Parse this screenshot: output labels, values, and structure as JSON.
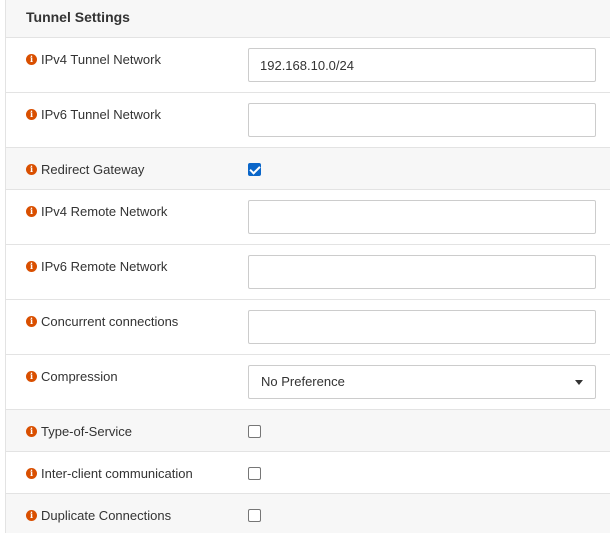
{
  "section": {
    "title": "Tunnel Settings"
  },
  "colors": {
    "info_icon": "#d94f00",
    "checkbox_checked": "#0a66c9",
    "row_shade": "#f7f7f7",
    "border": "#e3e3e3"
  },
  "info_icon": {
    "glyph": "i",
    "icon": "info-circle"
  },
  "fields": {
    "ipv4_tunnel_network": {
      "label": "IPv4 Tunnel Network",
      "value": "192.168.10.0/24"
    },
    "ipv6_tunnel_network": {
      "label": "IPv6 Tunnel Network",
      "value": ""
    },
    "redirect_gateway": {
      "label": "Redirect Gateway",
      "checked": true
    },
    "ipv4_remote_network": {
      "label": "IPv4 Remote Network",
      "value": ""
    },
    "ipv6_remote_network": {
      "label": "IPv6 Remote Network",
      "value": ""
    },
    "concurrent_connections": {
      "label": "Concurrent connections",
      "value": ""
    },
    "compression": {
      "label": "Compression",
      "selected": "No Preference"
    },
    "type_of_service": {
      "label": "Type-of-Service",
      "checked": false
    },
    "inter_client_communication": {
      "label": "Inter-client communication",
      "checked": false
    },
    "duplicate_connections": {
      "label": "Duplicate Connections",
      "checked": false
    }
  }
}
